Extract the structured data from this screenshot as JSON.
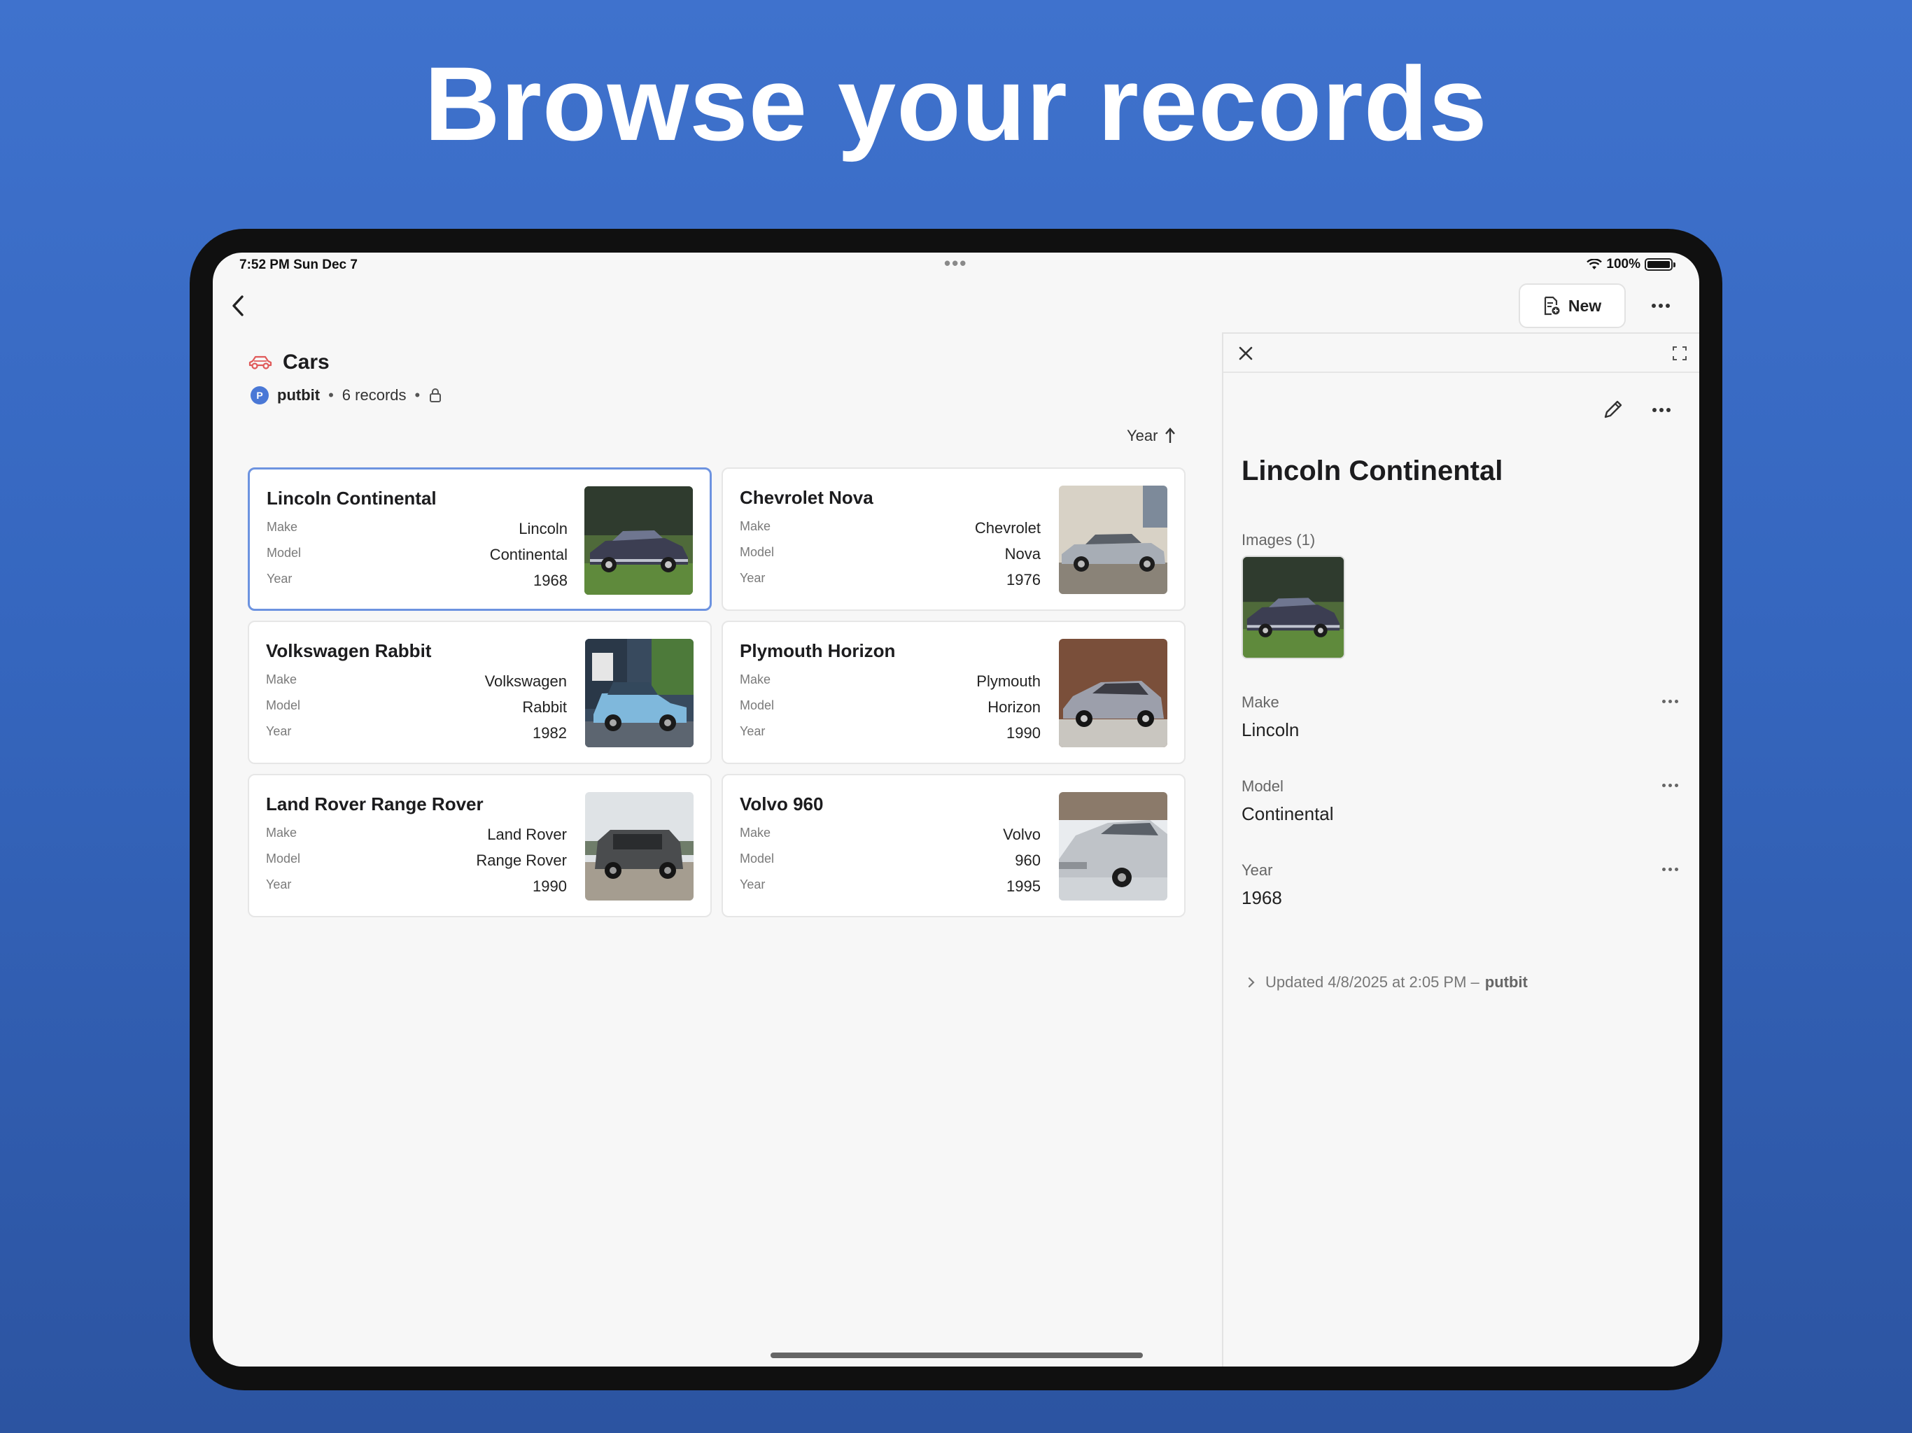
{
  "headline": "Browse your records",
  "status": {
    "time": "7:52 PM   Sun Dec 7",
    "battery": "100%"
  },
  "toolbar": {
    "new_label": "New"
  },
  "collection": {
    "title": "Cars",
    "owner": "putbit",
    "owner_initial": "P",
    "records": "6 records",
    "separator": "•"
  },
  "sort": {
    "label": "Year"
  },
  "cards": [
    {
      "title": "Lincoln Continental",
      "make_label": "Make",
      "make": "Lincoln",
      "model_label": "Model",
      "model": "Continental",
      "year_label": "Year",
      "year": "1968"
    },
    {
      "title": "Chevrolet Nova",
      "make_label": "Make",
      "make": "Chevrolet",
      "model_label": "Model",
      "model": "Nova",
      "year_label": "Year",
      "year": "1976"
    },
    {
      "title": "Volkswagen Rabbit",
      "make_label": "Make",
      "make": "Volkswagen",
      "model_label": "Model",
      "model": "Rabbit",
      "year_label": "Year",
      "year": "1982"
    },
    {
      "title": "Plymouth Horizon",
      "make_label": "Make",
      "make": "Plymouth",
      "model_label": "Model",
      "model": "Horizon",
      "year_label": "Year",
      "year": "1990"
    },
    {
      "title": "Land Rover Range Rover",
      "make_label": "Make",
      "make": "Land Rover",
      "model_label": "Model",
      "model": "Range Rover",
      "year_label": "Year",
      "year": "1990"
    },
    {
      "title": "Volvo 960",
      "make_label": "Make",
      "make": "Volvo",
      "model_label": "Model",
      "model": "960",
      "year_label": "Year",
      "year": "1995"
    }
  ],
  "detail": {
    "title": "Lincoln Continental",
    "images_label": "Images (1)",
    "make_label": "Make",
    "make": "Lincoln",
    "model_label": "Model",
    "model": "Continental",
    "year_label": "Year",
    "year": "1968",
    "updated_prefix": "Updated 4/8/2025 at 2:05 PM –",
    "updated_by": "putbit"
  },
  "colors": {
    "background": "#3f72cd",
    "accent": "#4a78d6",
    "selected_border": "#6d93e0",
    "car_icon": "#e05a5a"
  }
}
